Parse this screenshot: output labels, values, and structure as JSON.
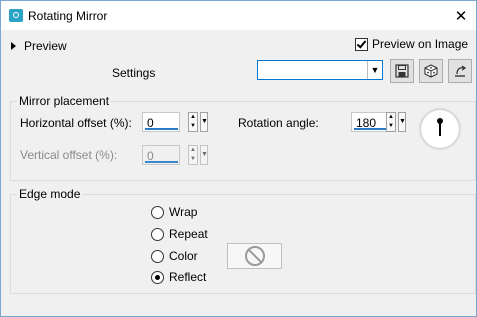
{
  "window": {
    "title": "Rotating Mirror",
    "close_glyph": "✕"
  },
  "preview": {
    "label": "Preview",
    "preview_on_image_label": "Preview on Image",
    "preview_on_image_checked": true
  },
  "settings": {
    "label": "Settings",
    "value": ""
  },
  "toolbar": {
    "save_icon": "save-icon",
    "random_icon": "dice-icon",
    "reset_icon": "reset-icon"
  },
  "mirror_placement": {
    "title": "Mirror placement",
    "horizontal_offset": {
      "label": "Horizontal offset (%):",
      "value": "0"
    },
    "vertical_offset": {
      "label": "Vertical offset (%):",
      "value": "0",
      "disabled": true
    },
    "rotation_angle": {
      "label": "Rotation angle:",
      "value": "180"
    }
  },
  "edge_mode": {
    "title": "Edge mode",
    "options": [
      {
        "label": "Wrap",
        "selected": false
      },
      {
        "label": "Repeat",
        "selected": false
      },
      {
        "label": "Color",
        "selected": false
      },
      {
        "label": "Reflect",
        "selected": true
      }
    ],
    "color_swatch_icon": "no-color-icon"
  },
  "colors": {
    "accent": "#2b79c9",
    "window_border": "#7aa6cf",
    "app_icon": "#2aa3c7"
  }
}
